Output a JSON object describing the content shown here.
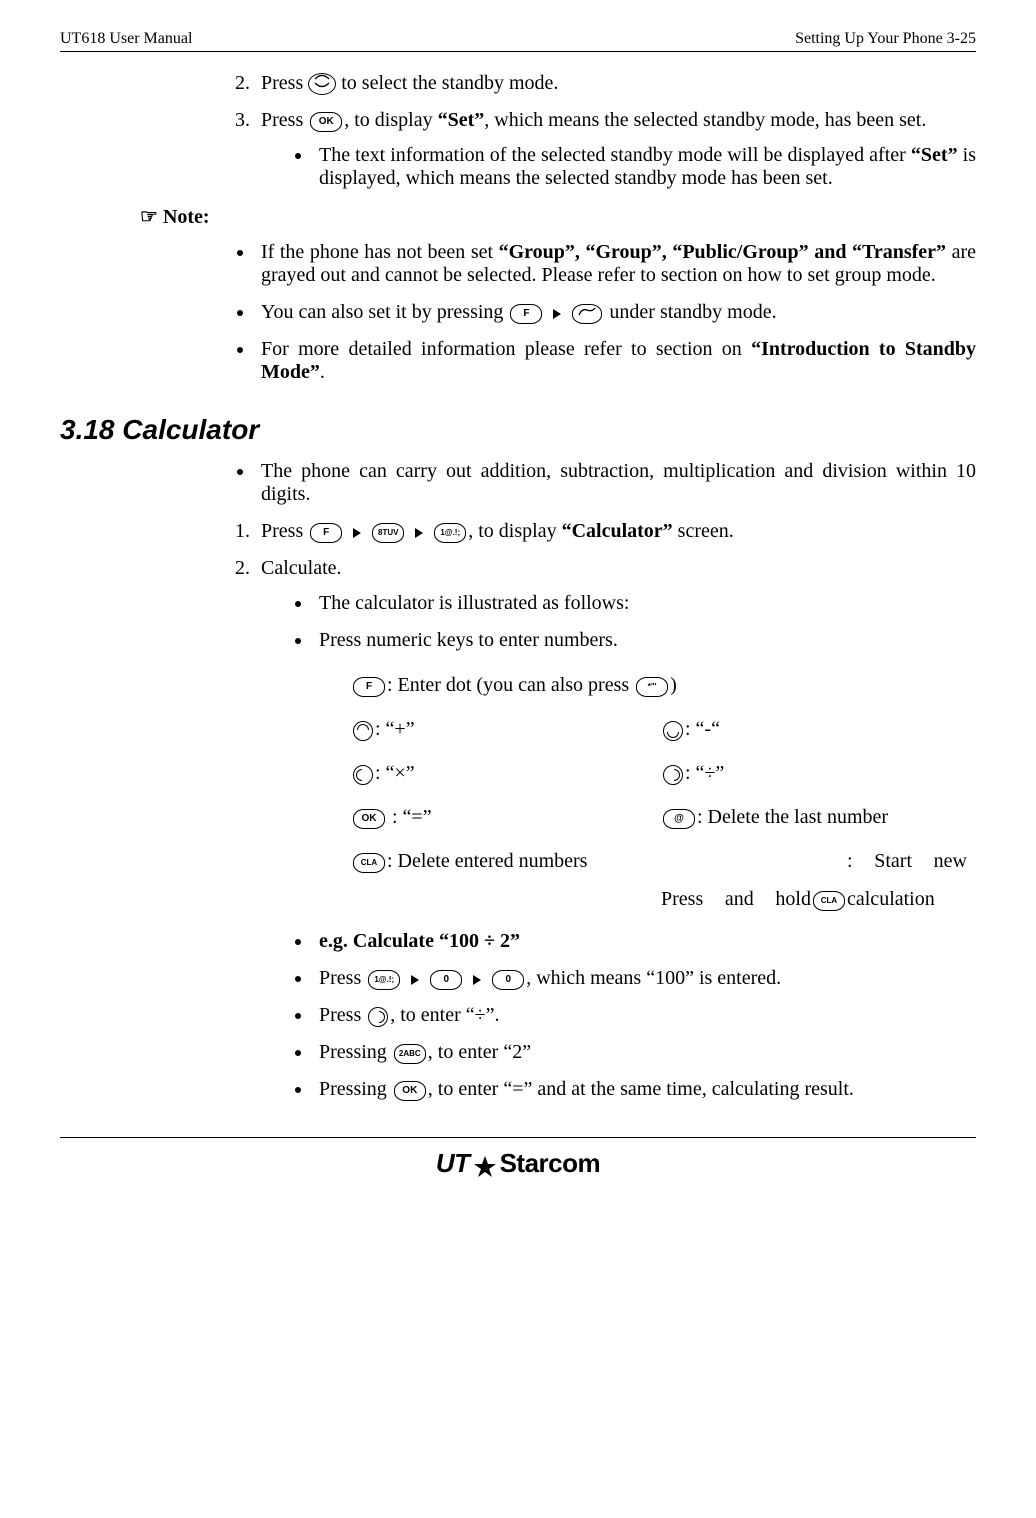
{
  "header": {
    "left": "UT618 User Manual",
    "right": "Setting Up Your Phone   3-25"
  },
  "step2": {
    "prefix": "Press ",
    "suffix": " to select the standby mode."
  },
  "step3": {
    "prefix": "Press ",
    "mid1": ", to display ",
    "set_word": "“Set”",
    "mid2": ", which means the selected standby mode, has been set."
  },
  "step3_sub1": {
    "a": "The text information of the selected standby mode will be displayed after ",
    "set_word": "“Set”",
    "b": " is displayed, which means the selected standby mode has been set."
  },
  "note_label": "Note:",
  "note_b1": {
    "a": "If the phone has not been set ",
    "bold": "“Group”, “Group”, “Public/Group” and “Transfer”",
    "b": " are grayed out and cannot be selected. Please refer to section on how to set group mode."
  },
  "note_b2": {
    "a": "You can also set it by pressing ",
    "b": " under standby mode."
  },
  "note_b3": {
    "a": "For more detailed information please refer to section on ",
    "bold": "“Introduction to Standby Mode”",
    "b": "."
  },
  "section_title": "3.18 Calculator",
  "calc_intro": "The phone can carry out addition, subtraction, multiplication and division within 10 digits.",
  "calc_step1": {
    "a": "Press ",
    "b": ", to display ",
    "bold": "“Calculator”",
    "c": " screen."
  },
  "calc_step2": "Calculate.",
  "calc_sub1": "The calculator is illustrated as follows:",
  "calc_sub2": "Press numeric keys to enter numbers.",
  "row_f": {
    "a": ":  Enter dot (you can also press ",
    "b": ")"
  },
  "row_plus": ": “+”",
  "row_minus": ": “-“",
  "row_mult": ": “×”",
  "row_div": ": “÷”",
  "row_eq": " : “=”",
  "row_del_last": ": Delete the last number",
  "row_del_all": ": Delete entered numbers",
  "row_start_new_a": "Press and hold",
  "row_start_new_b": ": Start new calculation",
  "eg_title": "e.g. Calculate “100 ÷ 2”",
  "eg_b1": {
    "a": "Press  ",
    "b": ", which means “100” is entered."
  },
  "eg_b2": {
    "a": "Press ",
    "b": ", to enter “÷”."
  },
  "eg_b3": {
    "a": "Pressing ",
    "b": ", to enter  “2”"
  },
  "eg_b4": {
    "a": "Pressing ",
    "b": ", to enter “=” and at the same time, calculating result."
  },
  "keys": {
    "ok": "OK",
    "f": "F",
    "one": "1@.!;",
    "eight": "8TUV",
    "zero": "0",
    "two": "2ABC",
    "star": "*\"'",
    "cla": "CLA",
    "at": "@"
  },
  "footer": {
    "brand_ut": "UT",
    "brand_rest": "Starcom"
  }
}
